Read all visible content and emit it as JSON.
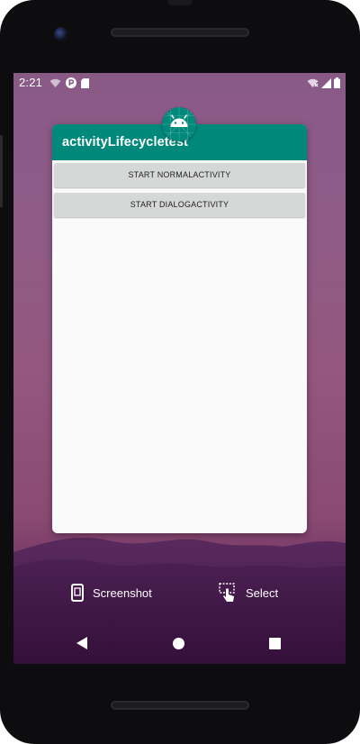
{
  "status_bar": {
    "time": "2:21"
  },
  "recent_app": {
    "title": "activityLifecycletest",
    "buttons": [
      {
        "label": "START NORMALACTIVITY"
      },
      {
        "label": "START DIALOGACTIVITY"
      }
    ],
    "icon": "android-icon",
    "appbar_color": "#00897b"
  },
  "overview_actions": {
    "screenshot_label": "Screenshot",
    "select_label": "Select"
  },
  "navigation": {
    "back_icon": "back-triangle-icon",
    "home_icon": "home-circle-icon",
    "recents_icon": "recents-square-icon"
  }
}
